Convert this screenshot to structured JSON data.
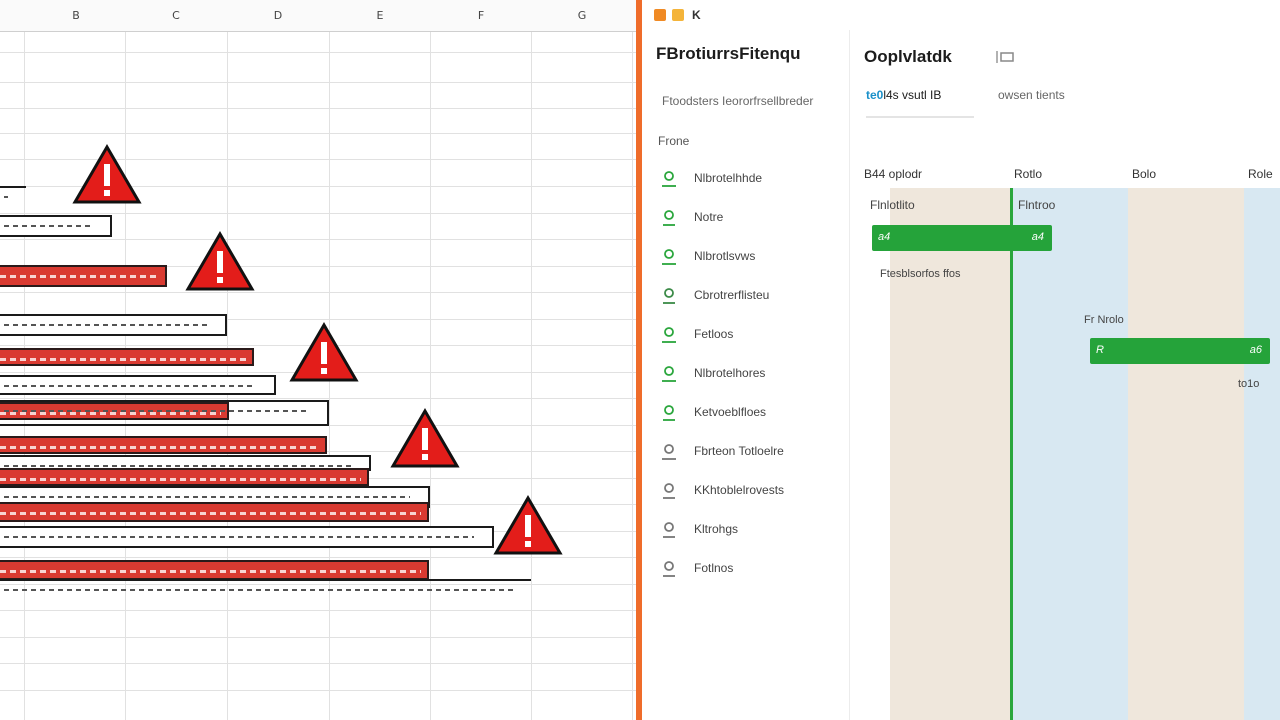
{
  "spreadsheet": {
    "columns": [
      "B",
      "C",
      "D",
      "E",
      "F",
      "G"
    ]
  },
  "app": {
    "window_label": "K",
    "sidebar": {
      "project_title": "FBrotiurrsFitenqu",
      "subtitle": "Ftoodsters Ieororfrsellbreder",
      "section_label": "Frone",
      "items": [
        {
          "label": "Nlbrotelhhde"
        },
        {
          "label": "Notre"
        },
        {
          "label": "Nlbrotlsvws"
        },
        {
          "label": "Cbrotrerflisteu"
        },
        {
          "label": "Fetloos"
        },
        {
          "label": "Nlbrotelhores"
        },
        {
          "label": "Ketvoeblfloes"
        },
        {
          "label": "Fbrteon Totloelre"
        },
        {
          "label": "KKhtoblelrovests"
        },
        {
          "label": "Kltrohgs"
        },
        {
          "label": "Fotlnos"
        }
      ]
    },
    "main": {
      "title": "Ooplvlatdk",
      "tabs": [
        {
          "prefix": "te0",
          "label": "l4s vsutl IB"
        },
        {
          "prefix": "",
          "label": "owsen tients"
        }
      ],
      "gantt": {
        "columns": [
          "B44 oplodr",
          "Rotlo",
          "Bolo",
          "Role"
        ],
        "rows": [
          {
            "label": "Flnlotlito"
          },
          {
            "label": "Flntroo"
          },
          {
            "label": "Ftesblsorfos ffos"
          },
          {
            "label": "Fr Nrolo"
          },
          {
            "label": "to1o"
          }
        ],
        "tasks": [
          {
            "start_tag": "a4",
            "end_tag": "a4"
          },
          {
            "start_tag": "R",
            "end_tag": "a6"
          }
        ]
      }
    }
  }
}
